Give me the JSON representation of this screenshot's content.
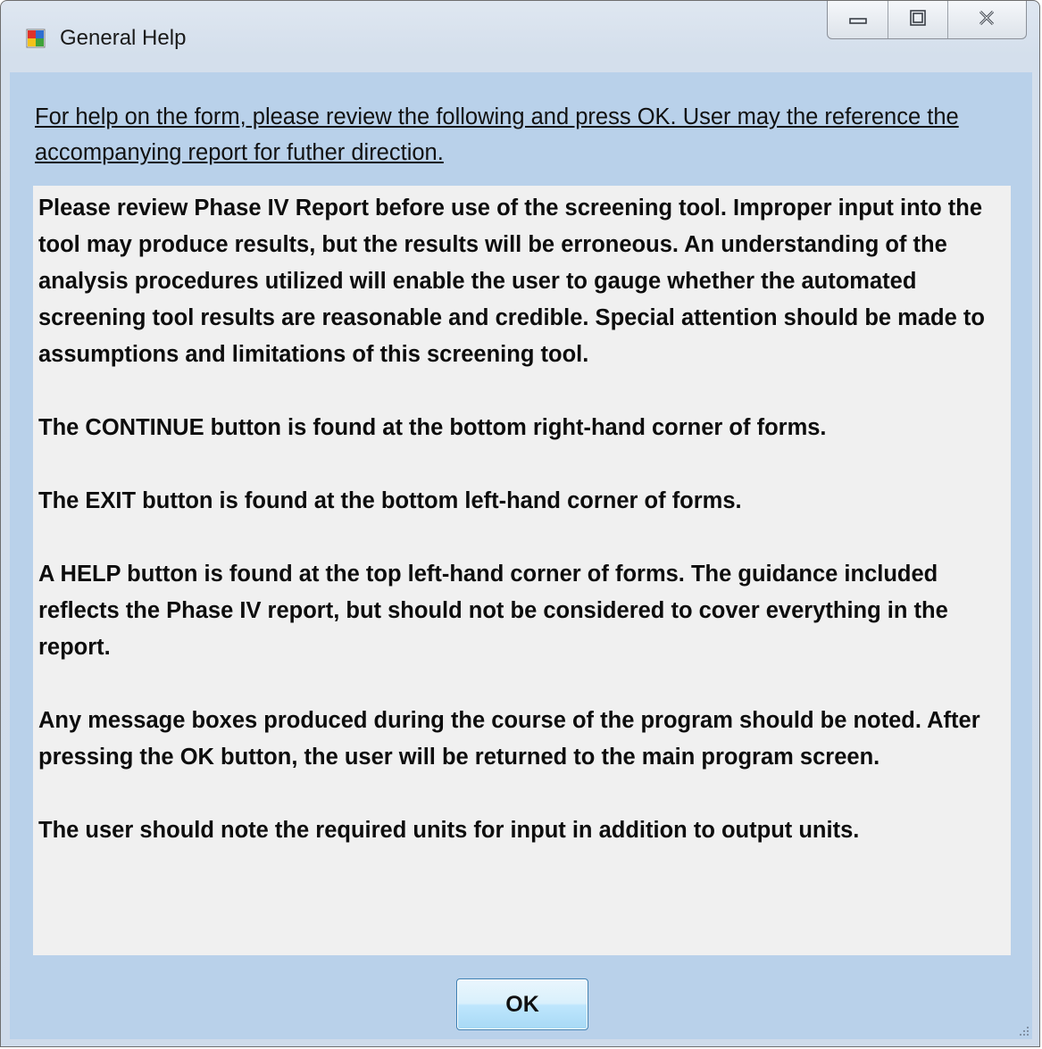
{
  "window": {
    "title": "General Help",
    "icon": "application-form-icon",
    "caption_buttons": [
      {
        "name": "minimize-button",
        "icon": "minimize-icon"
      },
      {
        "name": "maximize-button",
        "icon": "maximize-icon"
      },
      {
        "name": "close-button",
        "icon": "close-icon"
      }
    ]
  },
  "form": {
    "heading": "For help on the form, please review the following and press OK.  User may the reference the accompanying report for futher direction.",
    "help_paragraphs": [
      "Please review Phase IV Report before use of the screening tool.  Improper input into the tool may produce results, but the results will be erroneous.  An understanding of the analysis procedures utilized will enable the user to gauge whether the automated screening tool results are reasonable and credible.  Special attention should be made to assumptions and limitations of this screening tool.",
      "The CONTINUE button is found at the bottom right-hand corner of forms.",
      "The EXIT button is found at the bottom left-hand corner of forms.",
      "A HELP button is found at the top left-hand corner of forms.  The guidance included reflects the Phase IV report, but should not be considered to cover everything in the report.",
      "Any message boxes produced during the course of the program should be noted.  After pressing the OK button, the user will be returned to the main program screen.",
      "The user should note the required units for input in addition to output units."
    ],
    "ok_label": "OK"
  },
  "colors": {
    "client_background": "#b9d1ea",
    "textbox_background": "#f0f0f0",
    "ok_button_border": "#3c7fb1"
  }
}
